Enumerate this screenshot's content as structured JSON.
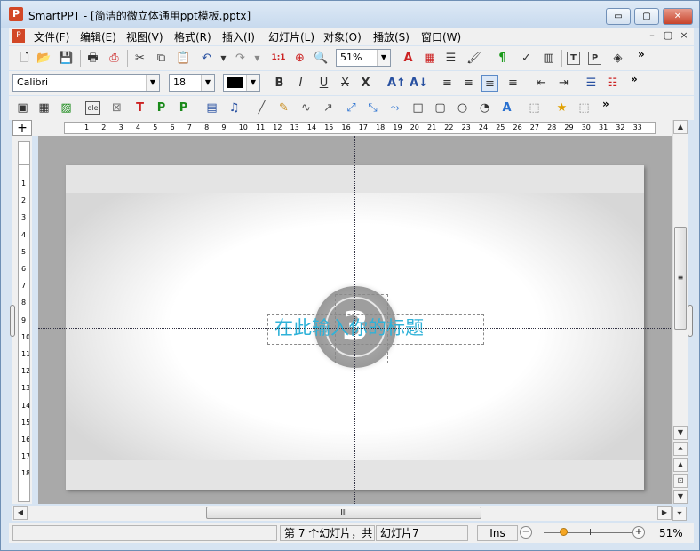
{
  "app": {
    "icon_letter": "P",
    "title": "SmartPPT - [简洁的微立体通用ppt模板.pptx]"
  },
  "window_controls": {
    "minimize": "▭",
    "maximize": "▢",
    "close": "✕"
  },
  "mdi_controls": {
    "minimize": "–",
    "restore": "▢",
    "close": "×"
  },
  "menu": {
    "items": [
      "文件(F)",
      "编辑(E)",
      "视图(V)",
      "格式(R)",
      "插入(I)",
      "幻灯片(L)",
      "对象(O)",
      "播放(S)",
      "窗口(W)"
    ]
  },
  "toolbar1": {
    "zoom_value": "51%",
    "more": "»"
  },
  "toolbar2": {
    "font_name": "Calibri",
    "font_size": "18",
    "text_color": "#000000",
    "more": "»"
  },
  "toolbar3": {
    "more": "»"
  },
  "ruler": {
    "corner": "+",
    "h_labels": [
      "1",
      "2",
      "3",
      "4",
      "5",
      "6",
      "7",
      "8",
      "9",
      "10",
      "11",
      "12",
      "13",
      "14",
      "15",
      "16",
      "17",
      "18",
      "19",
      "20",
      "21",
      "22",
      "23",
      "24",
      "25",
      "26",
      "27",
      "28",
      "29",
      "30",
      "31",
      "32",
      "33"
    ],
    "v_labels": [
      "1",
      "2",
      "3",
      "4",
      "5",
      "6",
      "7",
      "8",
      "9",
      "10",
      "11",
      "12",
      "13",
      "14",
      "15",
      "16",
      "17",
      "18"
    ]
  },
  "slide": {
    "number_badge": "3",
    "title_placeholder": "在此输入你的标题",
    "accent_color": "#2fb2d8"
  },
  "scroll": {
    "up": "▲",
    "down": "▼",
    "left": "◀",
    "right": "▶",
    "grip": "≡",
    "hgrip": "III",
    "page_up": "⏶",
    "prev": "▲",
    "restore": "⊡",
    "next": "▼",
    "page_down": "⏷"
  },
  "status": {
    "slide_info": "第 7 个幻灯片，共",
    "slide_name": "幻灯片7",
    "ins": "Ins",
    "zoom_minus": "−",
    "zoom_plus": "+",
    "zoom_level": 0.51,
    "zoom_text": "51%"
  }
}
